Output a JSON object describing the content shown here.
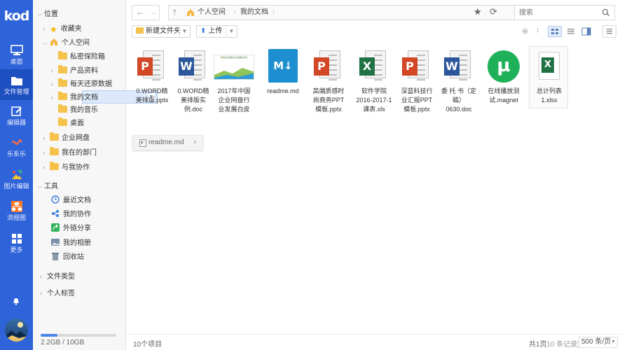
{
  "app": {
    "logo": "kod"
  },
  "rail": {
    "items": [
      {
        "label": "桌面",
        "icon": "desktop-icon"
      },
      {
        "label": "文件管理",
        "icon": "folder-icon"
      },
      {
        "label": "编辑器",
        "icon": "edit-icon"
      },
      {
        "label": "乐系乐",
        "icon": "music-icon"
      },
      {
        "label": "图片编辑",
        "icon": "image-edit-icon"
      },
      {
        "label": "流程图",
        "icon": "flowchart-icon"
      },
      {
        "label": "更多",
        "icon": "grid-icon"
      }
    ]
  },
  "tree": {
    "location": "位置",
    "favorites": "收藏夹",
    "personal": "个人空间",
    "children": [
      "私密保险箱",
      "产品资料",
      "每天还原数据",
      "我的文档",
      "我的音乐",
      "桌面"
    ],
    "enterprise": "企业网盘",
    "dept": "我在的部门",
    "collab": "与我协作",
    "tools": "工具",
    "tool_items": [
      "最近文档",
      "我的协作",
      "外链分享",
      "我的相册",
      "回收站"
    ],
    "file_types": "文件类型",
    "tags": "个人标签"
  },
  "quota": {
    "text": "2.2GB / 10GB",
    "used_fraction": 0.22
  },
  "address": {
    "crumbs": [
      "个人空间",
      "我的文档"
    ]
  },
  "search": {
    "placeholder": "搜索"
  },
  "toolbar": {
    "new_folder": "新建文件夹",
    "upload": "上传"
  },
  "files": [
    {
      "name": "0.WORD精美排版.pptx",
      "type": "pptx"
    },
    {
      "name": "0.WORD精美排版实例.doc",
      "type": "doc"
    },
    {
      "name": "2017年中国企业网盘行业发展白皮",
      "type": "image"
    },
    {
      "name": "readme.md",
      "type": "md"
    },
    {
      "name": "高端质感时尚商务PPT模板.pptx",
      "type": "pptx"
    },
    {
      "name": "软件学院2016-2017-1课表.xls",
      "type": "xls"
    },
    {
      "name": "深蓝科技行业汇报PPT模板.pptx",
      "type": "pptx"
    },
    {
      "name": "委 托 书（定稿）0630.doc",
      "type": "doc"
    },
    {
      "name": "在线播放测试.magnet",
      "type": "magnet"
    },
    {
      "name": "总计列表1.xlsx",
      "type": "xlsx"
    }
  ],
  "file_lines": [
    [
      "0.WORD精",
      "美排版.pptx"
    ],
    [
      "0.WORD精",
      "美排版实",
      "例.doc"
    ],
    [
      "2017年中国",
      "企业网盘行",
      "业发展白皮"
    ],
    [
      "readme.md"
    ],
    [
      "高端质感时",
      "尚商务PPT",
      "模板.pptx"
    ],
    [
      "软件学院",
      "2016-2017-1",
      "课表.xls"
    ],
    [
      "深蓝科技行",
      "业汇报PPT",
      "模板.pptx"
    ],
    [
      "委 托 书（定",
      "稿）",
      "0630.doc"
    ],
    [
      "在线播放测",
      "试.magnet"
    ],
    [
      "总计列表",
      "1.xlsx"
    ]
  ],
  "thumb_title": "中国企业网盘行业发展白皮书",
  "recent_file": "readme.md",
  "status": {
    "count": "10个项目",
    "page": "共1页",
    "records": "(10 条记录)",
    "per_page": "500 条/页"
  },
  "colors": {
    "rail": "#2f63d9",
    "accent": "#4a86e8",
    "ppt": "#d24726",
    "word": "#2b579a",
    "excel": "#207245",
    "md": "#1d8ecf",
    "magnet": "#1fb159"
  }
}
